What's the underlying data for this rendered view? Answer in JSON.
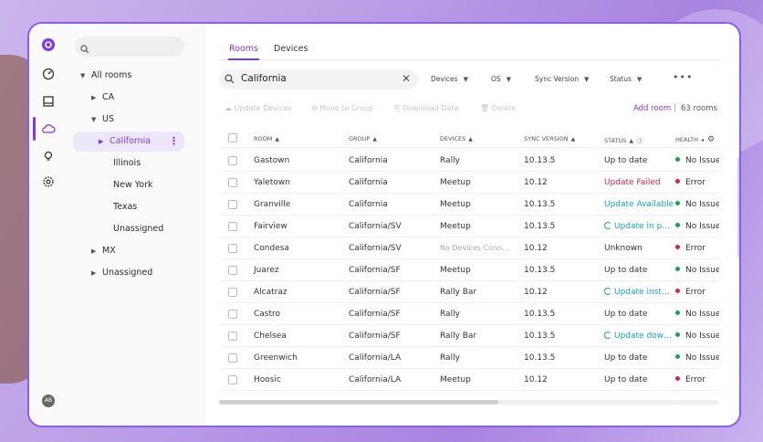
{
  "colors": {
    "accent": "#7c3aed",
    "error": "#e11d48",
    "info": "#0ea5c6",
    "ok": "#16a34a",
    "err_dot": "#e11d48"
  },
  "rail": {
    "items": [
      "logo-icon",
      "dashboard-icon",
      "book-icon",
      "cloud-icon",
      "lightbulb-icon",
      "settings-icon"
    ],
    "avatar": "AB"
  },
  "tree": {
    "all_rooms": "All rooms",
    "ca": "CA",
    "us": "US",
    "california": "California",
    "illinois": "Illinois",
    "new_york": "New York",
    "texas": "Texas",
    "unassigned_us": "Unassigned",
    "mx": "MX",
    "unassigned": "Unassigned"
  },
  "tabs": {
    "rooms": "Rooms",
    "devices": "Devices"
  },
  "search": {
    "value": "California"
  },
  "filters": {
    "devices": "Devices",
    "os": "OS",
    "sync": "Sync Version",
    "status": "Status",
    "more": "•••"
  },
  "actions": {
    "update_devices": "Update Devices",
    "move_group": "Move to Group",
    "download_data": "Download Data",
    "delete": "Delete",
    "add_room": "Add room",
    "sep": "|",
    "room_count": "63 rooms"
  },
  "table": {
    "headers": {
      "room": "Room",
      "group": "Group",
      "devices": "Devices",
      "sync": "Sync Version",
      "status": "Status",
      "health": "Health"
    },
    "rows": [
      {
        "room": "Gastown",
        "group": "California",
        "devices": "Rally",
        "sync": "10.13.5",
        "status": "Up to date",
        "status_type": "ok",
        "health": "No Issues",
        "health_type": "ok"
      },
      {
        "room": "Yaletown",
        "group": "California",
        "devices": "Meetup",
        "sync": "10.12",
        "status": "Update Failed",
        "status_type": "failed",
        "health": "Error",
        "health_type": "err"
      },
      {
        "room": "Granville",
        "group": "California",
        "devices": "Meetup",
        "sync": "10.13.5",
        "status": "Update Available",
        "status_type": "avail",
        "health": "No Issues",
        "health_type": "ok"
      },
      {
        "room": "Fairview",
        "group": "California/SV",
        "devices": "Meetup",
        "sync": "10.13.5",
        "status": "Update in p…",
        "status_type": "prog",
        "health": "No Issues",
        "health_type": "ok"
      },
      {
        "room": "Condesa",
        "group": "California/SV",
        "devices": "No Devices Conn…",
        "devices_dim": true,
        "sync": "10.12",
        "status": "Unknown",
        "status_type": "ok",
        "health": "Error",
        "health_type": "err"
      },
      {
        "room": "Juarez",
        "group": "California/SF",
        "devices": "Meetup",
        "sync": "10.13.5",
        "status": "Up to date",
        "status_type": "ok",
        "health": "No Issues",
        "health_type": "ok"
      },
      {
        "room": "Alcatraz",
        "group": "California/SF",
        "devices": "Rally Bar",
        "sync": "10.12",
        "status": "Update inst…",
        "status_type": "prog",
        "health": "Error",
        "health_type": "err"
      },
      {
        "room": "Castro",
        "group": "California/SF",
        "devices": "Rally",
        "sync": "10.13.5",
        "status": "Up to date",
        "status_type": "ok",
        "health": "No Issues",
        "health_type": "ok"
      },
      {
        "room": "Chelsea",
        "group": "California/SF",
        "devices": "Rally Bar",
        "sync": "10.13.5",
        "status": "Update dow…",
        "status_type": "prog",
        "health": "No Issues",
        "health_type": "ok"
      },
      {
        "room": "Greenwich",
        "group": "California/LA",
        "devices": "Rally",
        "sync": "10.13.5",
        "status": "Up to date",
        "status_type": "ok",
        "health": "No Issues",
        "health_type": "ok"
      },
      {
        "room": "Hoosic",
        "group": "California/LA",
        "devices": "Meetup",
        "sync": "10.12",
        "status": "Up to date",
        "status_type": "ok",
        "health": "Error",
        "health_type": "err"
      }
    ]
  }
}
